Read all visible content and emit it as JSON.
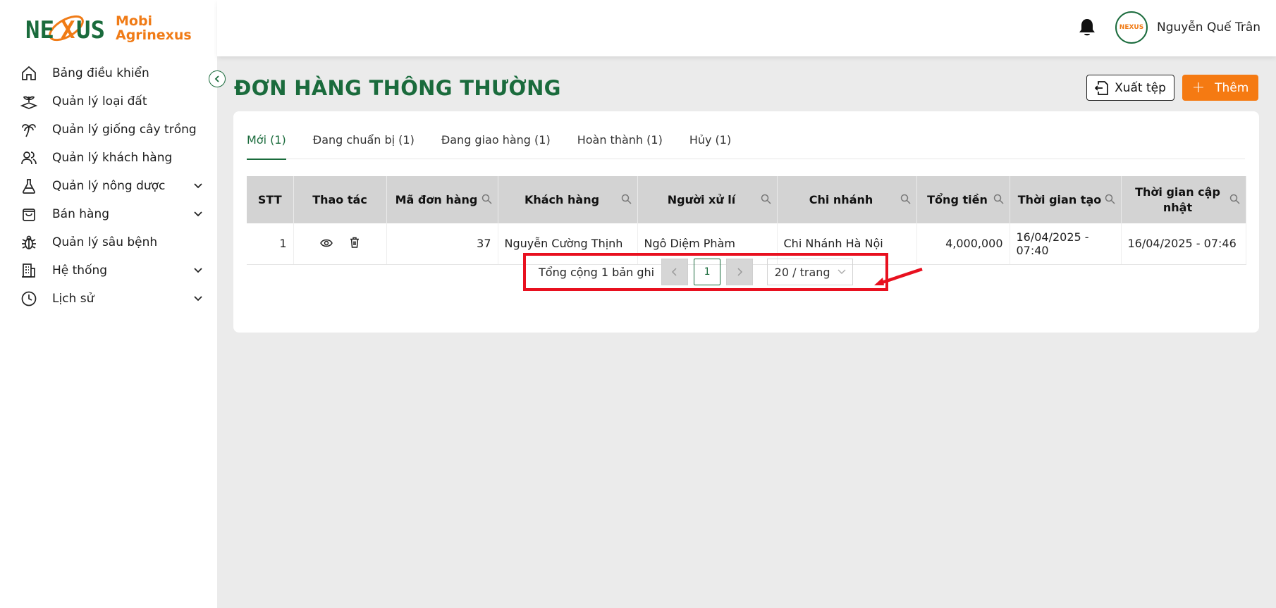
{
  "brand": {
    "line1": "Mobi",
    "line2": "Agrinexus",
    "mark_text": "NEXUS",
    "primary_color": "#1a6b3c",
    "accent_color": "#f57a12"
  },
  "sidebar": {
    "items": [
      {
        "label": "Bảng điều khiển",
        "icon": "home-icon",
        "has_children": false
      },
      {
        "label": "Quản lý loại đất",
        "icon": "soil-plant-icon",
        "has_children": false
      },
      {
        "label": "Quản lý giống cây trồng",
        "icon": "palm-tree-icon",
        "has_children": false
      },
      {
        "label": "Quản lý khách hàng",
        "icon": "users-icon",
        "has_children": false
      },
      {
        "label": "Quản lý nông dược",
        "icon": "flask-icon",
        "has_children": true
      },
      {
        "label": "Bán hàng",
        "icon": "shopping-bag-icon",
        "has_children": true
      },
      {
        "label": "Quản lý sâu bệnh",
        "icon": "bug-icon",
        "has_children": false
      },
      {
        "label": "Hệ thống",
        "icon": "building-icon",
        "has_children": true
      },
      {
        "label": "Lịch sử",
        "icon": "clock-icon",
        "has_children": true
      }
    ]
  },
  "header": {
    "username": "Nguyễn Quế Trân",
    "avatar_text": "NEXUS"
  },
  "main": {
    "title": "ĐƠN HÀNG THÔNG THƯỜNG",
    "export_label": "Xuất tệp",
    "add_label": "Thêm",
    "tabs": [
      {
        "label": "Mới (1)",
        "active": true
      },
      {
        "label": "Đang chuẩn bị (1)",
        "active": false
      },
      {
        "label": "Đang giao hàng (1)",
        "active": false
      },
      {
        "label": "Hoàn thành (1)",
        "active": false
      },
      {
        "label": "Hủy (1)",
        "active": false
      }
    ],
    "table": {
      "columns": [
        "STT",
        "Thao tác",
        "Mã đơn hàng",
        "Khách hàng",
        "Người xử lí",
        "Chi nhánh",
        "Tổng tiền",
        "Thời gian tạo",
        "Thời gian cập nhật"
      ],
      "rows": [
        {
          "stt": "1",
          "order_id": "37",
          "customer": "Nguyễn Cường Thịnh",
          "handler": "Ngô Diệm Phàm",
          "branch": "Chi Nhánh Hà Nội",
          "total": "4,000,000",
          "created": "16/04/2025 - 07:40",
          "updated": "16/04/2025 - 07:46"
        }
      ]
    },
    "pagination": {
      "total_text": "Tổng cộng 1 bản ghi",
      "current_page": "1",
      "page_size": "20 / trang"
    }
  }
}
